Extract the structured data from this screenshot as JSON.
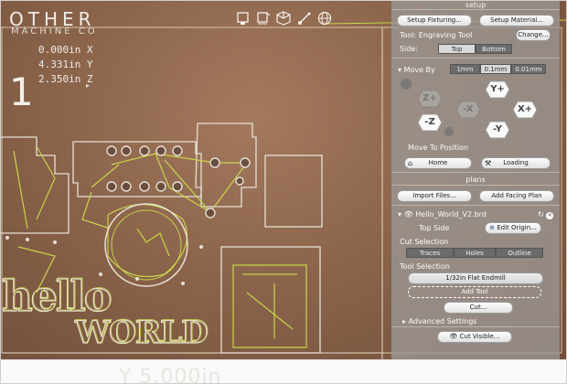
{
  "brand": {
    "line1": "OTHER",
    "line2": "MACHINE CO"
  },
  "readout": {
    "big_number": "1",
    "x": "0.000in X",
    "y": "4.331in Y",
    "z": "2.350in Z",
    "arrow": "▸",
    "bottom": "Y 5.000in"
  },
  "view_icons": [
    "top-view-icon",
    "front-view-icon",
    "iso-view-icon",
    "measure-icon",
    "globe-icon"
  ],
  "setup": {
    "title": "setup",
    "fixturing_label": "Setup Fixturing...",
    "material_label": "Setup Material...",
    "tool_text": "Tool: Engraving Tool",
    "change_label": "Change...",
    "side_label": "Side:",
    "side_options": [
      "Top",
      "Bottom"
    ],
    "side_selected": "Top"
  },
  "move": {
    "move_by_label": "Move By",
    "step_options": [
      "1mm",
      "0.1mm",
      "0.01mm"
    ],
    "step_selected": "0.1mm",
    "z_plus": "Z+",
    "z_minus": "-Z",
    "x_minus": "-X",
    "x_plus": "X+",
    "y_plus": "Y+",
    "y_minus": "-Y",
    "move_to_label": "Move To Position",
    "home_label": "Home",
    "loading_label": "Loading"
  },
  "plans": {
    "title": "plans",
    "import_label": "Import Files...",
    "facing_label": "Add Facing Plan",
    "file_name": "Hello_World_V2.brd",
    "top_side_label": "Top Side",
    "edit_origin_label": "Edit Origin...",
    "cut_selection_label": "Cut Selection",
    "cut_options": [
      "Traces",
      "Holes",
      "Outline"
    ],
    "tool_selection_label": "Tool Selection",
    "tool_name": "1/32in Flat Endmill",
    "add_tool_label": "Add Tool",
    "cut_label": "Cut...",
    "advanced_label": "Advanced Settings",
    "cut_visible_label": "Cut Visible..."
  },
  "colors": {
    "canvas": "#8a634a",
    "panel": "#9b9692",
    "trace": "#c8d44a",
    "outline": "#f0ece4"
  }
}
